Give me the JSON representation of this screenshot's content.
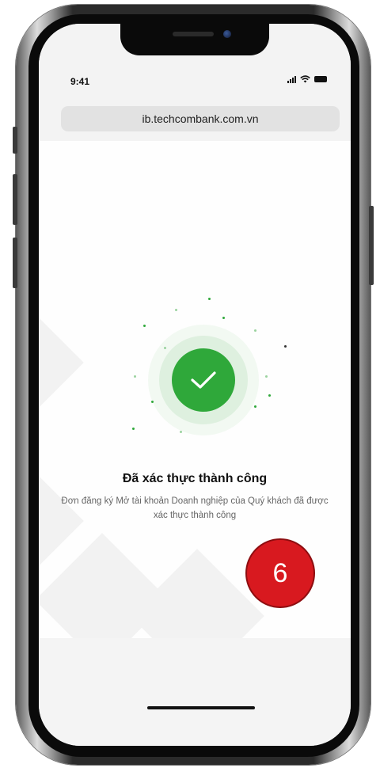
{
  "status_bar": {
    "time": "9:41",
    "icons": [
      "signal-icon",
      "wifi-icon",
      "battery-icon"
    ]
  },
  "browser": {
    "url": "ib.techcombank.com.vn"
  },
  "success": {
    "icon": "checkmark-icon",
    "title": "Đã xác thực thành công",
    "message": "Đơn đăng ký Mở tài khoản Doanh nghiệp của Quý khách đã được xác thực thành công"
  },
  "step_badge": {
    "number": "6"
  },
  "colors": {
    "success_green": "#2fa83a",
    "badge_red": "#d8191f"
  }
}
